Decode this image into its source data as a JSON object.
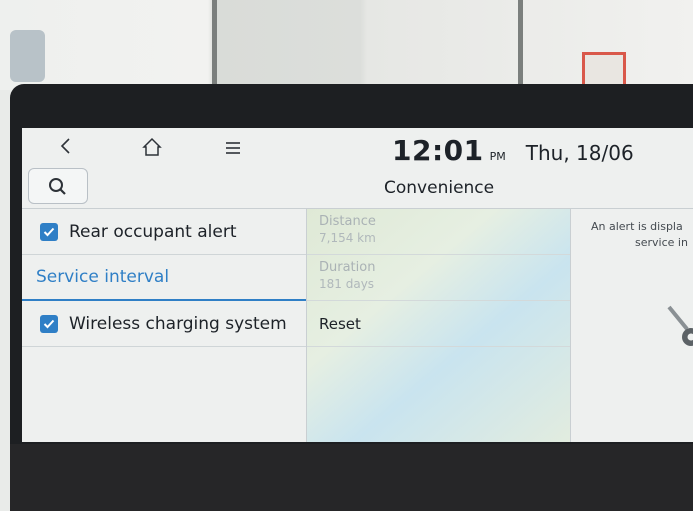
{
  "status_bar": {
    "time": "12:01",
    "ampm": "PM",
    "date": "Thu, 18/06"
  },
  "header": {
    "title": "Convenience"
  },
  "menu": {
    "items": [
      {
        "type": "checkbox",
        "label": "Rear occupant alert",
        "checked": true
      },
      {
        "type": "section",
        "label": "Service interval"
      },
      {
        "type": "checkbox",
        "label": "Wireless charging system",
        "checked": true
      }
    ]
  },
  "service_interval": {
    "distance_label": "Distance",
    "distance_value": "7,154 km",
    "duration_label": "Duration",
    "duration_value": "181 days",
    "reset_label": "Reset"
  },
  "info_panel": {
    "line1": "An alert is displa",
    "line2": "service in"
  },
  "colors": {
    "accent": "#2f7fc6",
    "text": "#1d2228",
    "screen_bg": "#eef0ef"
  },
  "icons": [
    "back-icon",
    "home-icon",
    "menu-icon",
    "search-icon",
    "wrench-icon"
  ]
}
